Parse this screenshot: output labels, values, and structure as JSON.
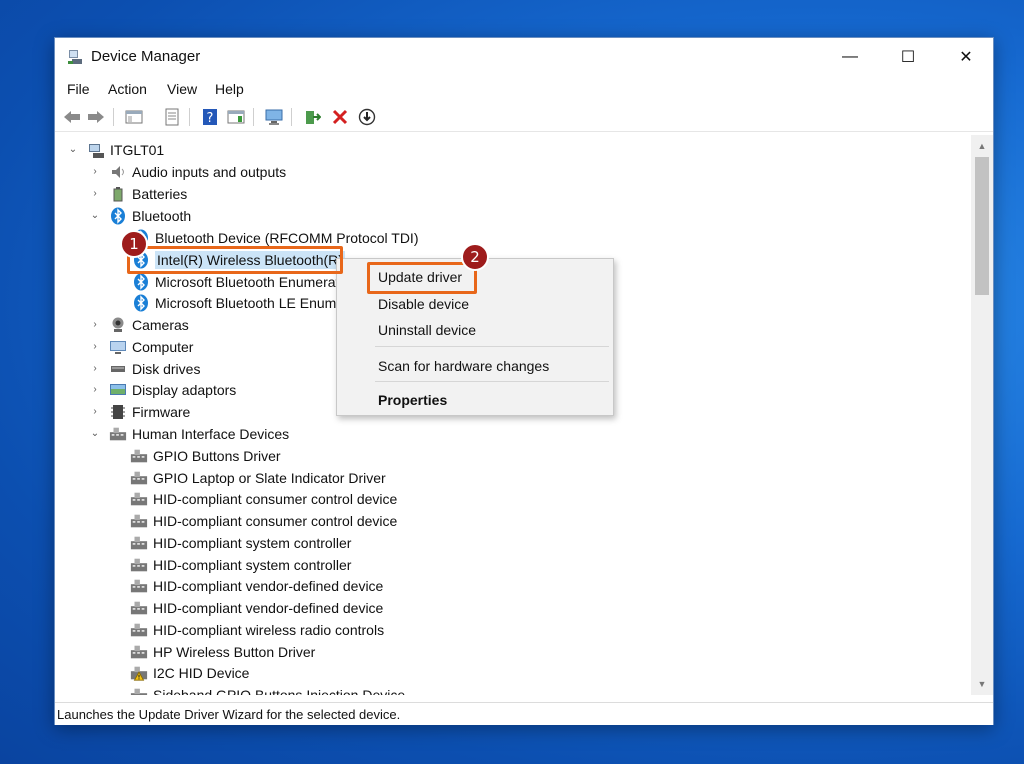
{
  "window": {
    "title": "Device Manager",
    "minimize_glyph": "—",
    "maximize_glyph": "☐",
    "close_glyph": "✕"
  },
  "menu": [
    "File",
    "Action",
    "View",
    "Help"
  ],
  "toolbar_icons": [
    "back-arrow-icon",
    "forward-arrow-icon",
    "show-hide-console-tree-icon",
    "properties-icon",
    "help-icon",
    "action-pane-icon",
    "scan-hardware-icon",
    "update-driver-icon",
    "uninstall-device-icon",
    "disable-device-icon"
  ],
  "tree": {
    "root": "ITGLT01",
    "items": [
      {
        "label": "Audio inputs and outputs",
        "icon": "speaker-icon"
      },
      {
        "label": "Batteries",
        "icon": "battery-icon"
      },
      {
        "label": "Bluetooth",
        "icon": "bluetooth-icon"
      },
      {
        "label": "Bluetooth Device (RFCOMM Protocol TDI)",
        "icon": "bluetooth-icon"
      },
      {
        "label": "Intel(R) Wireless Bluetooth(R)",
        "icon": "bluetooth-icon"
      },
      {
        "label": "Microsoft Bluetooth Enumerator",
        "icon": "bluetooth-icon"
      },
      {
        "label": "Microsoft Bluetooth LE Enumerator",
        "icon": "bluetooth-icon"
      },
      {
        "label": "Cameras",
        "icon": "camera-icon"
      },
      {
        "label": "Computer",
        "icon": "computer-icon"
      },
      {
        "label": "Disk drives",
        "icon": "disk-drive-icon"
      },
      {
        "label": "Display adaptors",
        "icon": "display-adapter-icon"
      },
      {
        "label": "Firmware",
        "icon": "firmware-icon"
      },
      {
        "label": "Human Interface Devices",
        "icon": "hid-icon"
      },
      {
        "label": "GPIO Buttons Driver",
        "icon": "hid-icon"
      },
      {
        "label": "GPIO Laptop or Slate Indicator Driver",
        "icon": "hid-icon"
      },
      {
        "label": "HID-compliant consumer control device",
        "icon": "hid-icon"
      },
      {
        "label": "HID-compliant consumer control device",
        "icon": "hid-icon"
      },
      {
        "label": "HID-compliant system controller",
        "icon": "hid-icon"
      },
      {
        "label": "HID-compliant system controller",
        "icon": "hid-icon"
      },
      {
        "label": "HID-compliant vendor-defined device",
        "icon": "hid-icon"
      },
      {
        "label": "HID-compliant vendor-defined device",
        "icon": "hid-icon"
      },
      {
        "label": "HID-compliant wireless radio controls",
        "icon": "hid-icon"
      },
      {
        "label": "HP Wireless Button Driver",
        "icon": "hid-icon"
      },
      {
        "label": "I2C HID Device",
        "icon": "warning-device-icon"
      },
      {
        "label": "Sideband GPIO Buttons Injection Device",
        "icon": "hid-icon"
      }
    ]
  },
  "context_menu": {
    "update": "Update driver",
    "disable": "Disable device",
    "uninstall": "Uninstall device",
    "scan": "Scan for hardware changes",
    "properties": "Properties"
  },
  "annotations": {
    "step1": "1",
    "step2": "2"
  },
  "status": "Launches the Update Driver Wizard for the selected device.",
  "colors": {
    "highlight": "#e8671a",
    "marker": "#9e1c1c",
    "selection": "#cce4f7",
    "bluetooth": "#1a7fd6"
  }
}
